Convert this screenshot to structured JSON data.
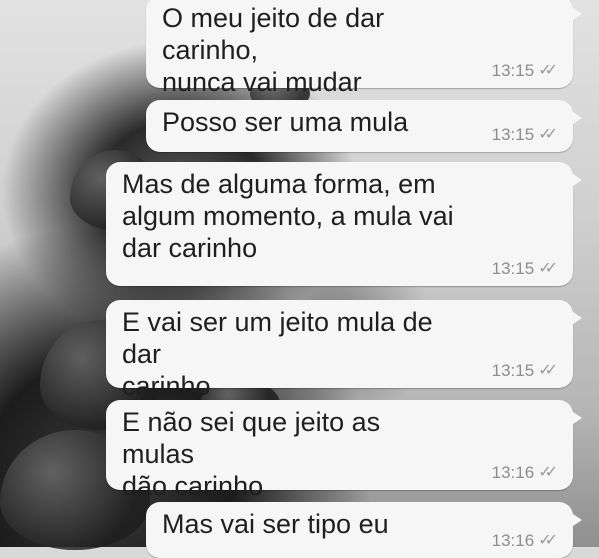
{
  "messages": [
    {
      "text": "O meu jeito de dar carinho,\nnunca vai mudar",
      "time": "13:15",
      "status_icon": "double-check-icon"
    },
    {
      "text": "Posso ser uma mula",
      "time": "13:15",
      "status_icon": "double-check-icon"
    },
    {
      "text": "Mas de alguma forma, em\nalgum momento, a mula vai\ndar carinho",
      "time": "13:15",
      "status_icon": "double-check-icon"
    },
    {
      "text": "E vai ser um jeito mula de dar\ncarinho",
      "time": "13:15",
      "status_icon": "double-check-icon"
    },
    {
      "text": "E não sei que jeito as mulas\ndão carinho",
      "time": "13:16",
      "status_icon": "double-check-icon"
    },
    {
      "text": "Mas vai ser tipo eu",
      "time": "13:16",
      "status_icon": "double-check-icon"
    }
  ],
  "colors": {
    "bubble": "#f6f6f6",
    "text": "#1f1f1f",
    "meta": "#8d8d8d"
  }
}
